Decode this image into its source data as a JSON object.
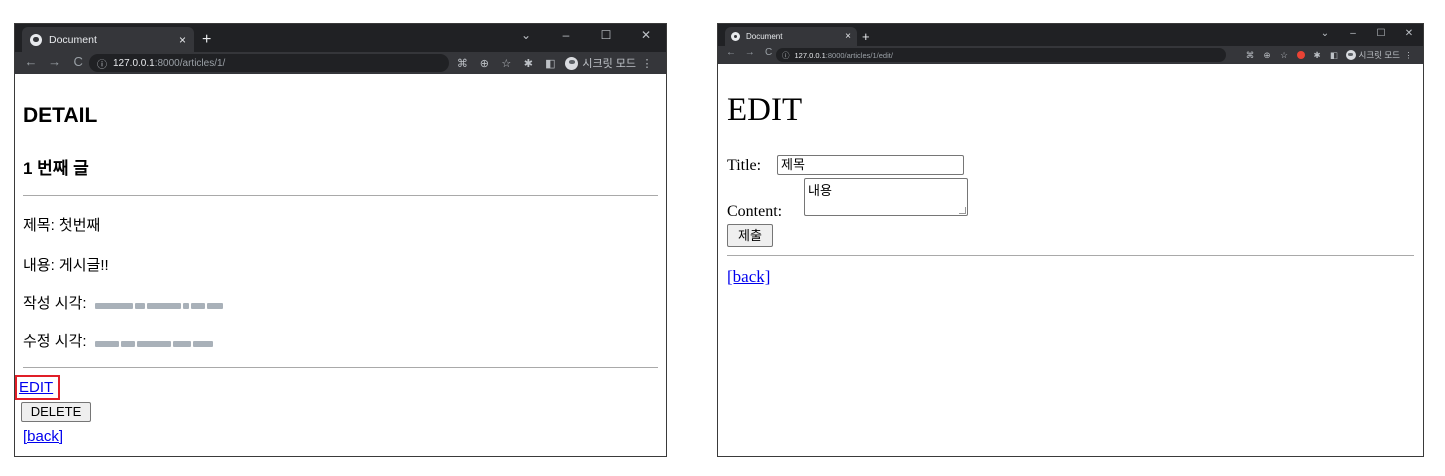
{
  "left_window": {
    "tab_title": "Document",
    "tab_close": "×",
    "new_tab": "+",
    "window_controls": [
      "⌄",
      "–",
      "☐",
      "✕"
    ],
    "nav": {
      "back": "←",
      "forward": "→",
      "reload": "C"
    },
    "url": {
      "info": "ⓘ",
      "host": "127.0.0.1",
      "path": ":8000/articles/1/"
    },
    "profile_label": "시크릿 모드",
    "menu": "⋮",
    "page": {
      "heading": "DETAIL",
      "subheading": "1 번째 글",
      "title_line": "제목: 첫번째",
      "content_line": "내용: 게시글!!",
      "created_label": "작성 시각:",
      "updated_label": "수정 시각:",
      "edit_link": "EDIT",
      "delete_button": "DELETE",
      "back_link": "[back]"
    },
    "highlight_color": "#e01e27"
  },
  "right_window": {
    "tab_title": "Document",
    "tab_close": "×",
    "new_tab": "+",
    "window_controls": [
      "⌄",
      "–",
      "☐",
      "✕"
    ],
    "nav": {
      "back": "←",
      "forward": "→",
      "reload": "C"
    },
    "url": {
      "info": "ⓘ",
      "host": "127.0.0.1",
      "path": ":8000/articles/1/edit/"
    },
    "profile_label": "시크릿 모드",
    "menu": "⋮",
    "page": {
      "heading": "EDIT",
      "title_label": "Title:",
      "title_value": "제목",
      "content_label": "Content:",
      "content_value": "내용",
      "submit_button": "제출",
      "back_link": "[back]"
    }
  }
}
